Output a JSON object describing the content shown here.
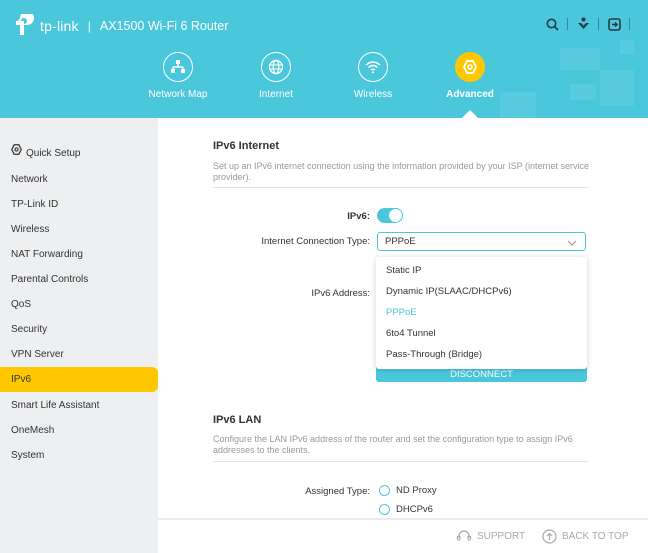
{
  "header": {
    "brand": "tp-link",
    "model": "AX1500 Wi-Fi 6 Router",
    "icons": [
      "search-icon",
      "download-app-icon",
      "logout-icon"
    ]
  },
  "nav": {
    "items": [
      {
        "label": "Network Map",
        "icon": "network-map-icon"
      },
      {
        "label": "Internet",
        "icon": "globe-icon"
      },
      {
        "label": "Wireless",
        "icon": "wifi-icon"
      },
      {
        "label": "Advanced",
        "icon": "gear-icon",
        "active": true
      }
    ]
  },
  "sidebar": {
    "items": [
      {
        "label": "Quick Setup",
        "icon": "gear-icon"
      },
      {
        "label": "Network"
      },
      {
        "label": "TP-Link ID"
      },
      {
        "label": "Wireless"
      },
      {
        "label": "NAT Forwarding"
      },
      {
        "label": "Parental Controls"
      },
      {
        "label": "QoS"
      },
      {
        "label": "Security"
      },
      {
        "label": "VPN Server"
      },
      {
        "label": "IPv6",
        "active": true
      },
      {
        "label": "Smart Life Assistant"
      },
      {
        "label": "OneMesh"
      },
      {
        "label": "System"
      }
    ]
  },
  "ipv6_internet": {
    "title": "IPv6 Internet",
    "description": "Set up an IPv6 internet connection using the information provided by your ISP (internet service provider).",
    "ipv6_label": "IPv6:",
    "ipv6_enabled": true,
    "connection_type_label": "Internet Connection Type:",
    "connection_type_value": "PPPoE",
    "connection_type_options": [
      "Static IP",
      "Dynamic IP(SLAAC/DHCPv6)",
      "PPPoE",
      "6to4 Tunnel",
      "Pass-Through (Bridge)"
    ],
    "ipv6_address_label": "IPv6 Address:",
    "disconnect_label": "DISCONNECT"
  },
  "ipv6_lan": {
    "title": "IPv6 LAN",
    "description": "Configure the LAN IPv6 address of the router and set the configuration type to assign IPv6 addresses to the clients.",
    "assigned_type_label": "Assigned Type:",
    "assigned_type_options": [
      "ND Proxy",
      "DHCPv6"
    ]
  },
  "footer": {
    "support_label": "SUPPORT",
    "back_to_top_label": "BACK TO TOP"
  },
  "colors": {
    "accent": "#4bc7dc",
    "highlight": "#ffc700",
    "sidebar_bg": "#eeeff1"
  }
}
